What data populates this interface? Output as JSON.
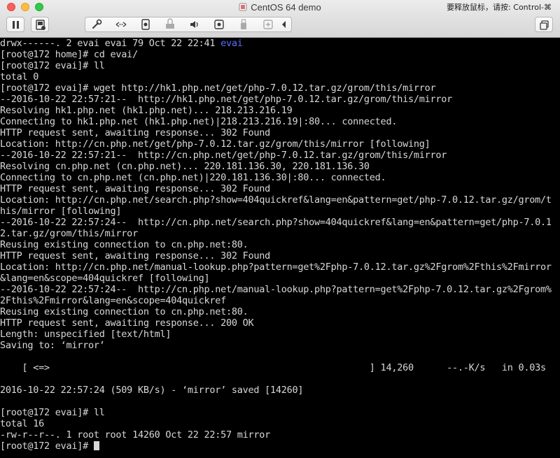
{
  "window": {
    "title": "CentOS 64 demo",
    "release_hint": "要释放鼠标，请按: Control-⌘",
    "colors": {
      "close": "#fc605c",
      "minimize": "#fdbc40",
      "zoom": "#34c84a",
      "terminal_bg": "#000000",
      "terminal_fg": "#d8d8d8",
      "directory": "#5c6cff"
    }
  },
  "toolbar": {
    "left": [
      {
        "name": "pause-button",
        "icon": "pause-icon"
      },
      {
        "name": "snapshot-button",
        "icon": "snapshot-icon"
      }
    ],
    "group": [
      {
        "name": "settings-button",
        "icon": "wrench-icon"
      },
      {
        "name": "network-button",
        "icon": "network-arrows-icon"
      },
      {
        "name": "hard-disk-button",
        "icon": "disk-icon"
      },
      {
        "name": "printer-button",
        "icon": "printer-icon"
      },
      {
        "name": "sound-button",
        "icon": "speaker-icon"
      },
      {
        "name": "camera-button",
        "icon": "camera-icon"
      },
      {
        "name": "usb-button",
        "icon": "usb-icon"
      },
      {
        "name": "sharing-button",
        "icon": "sharing-icon"
      },
      {
        "name": "more-button",
        "icon": "chevron-left-icon"
      }
    ],
    "right": [
      {
        "name": "fullscreen-button",
        "icon": "fullscreen-icon"
      }
    ]
  },
  "terminal": {
    "first_line": {
      "prefix": "drwx------. 2 evai evai 79 Oct 22 22:41 ",
      "dir": "evai"
    },
    "lines": [
      "[root@172 home]# cd evai/",
      "[root@172 evai]# ll",
      "total 0",
      "[root@172 evai]# wget http://hk1.php.net/get/php-7.0.12.tar.gz/grom/this/mirror",
      "--2016-10-22 22:57:21--  http://hk1.php.net/get/php-7.0.12.tar.gz/grom/this/mirror",
      "Resolving hk1.php.net (hk1.php.net)... 218.213.216.19",
      "Connecting to hk1.php.net (hk1.php.net)|218.213.216.19|:80... connected.",
      "HTTP request sent, awaiting response... 302 Found",
      "Location: http://cn.php.net/get/php-7.0.12.tar.gz/grom/this/mirror [following]",
      "--2016-10-22 22:57:21--  http://cn.php.net/get/php-7.0.12.tar.gz/grom/this/mirror",
      "Resolving cn.php.net (cn.php.net)... 220.181.136.30, 220.181.136.30",
      "Connecting to cn.php.net (cn.php.net)|220.181.136.30|:80... connected.",
      "HTTP request sent, awaiting response... 302 Found",
      "Location: http://cn.php.net/search.php?show=404quickref&lang=en&pattern=get/php-7.0.12.tar.gz/grom/t",
      "his/mirror [following]",
      "--2016-10-22 22:57:24--  http://cn.php.net/search.php?show=404quickref&lang=en&pattern=get/php-7.0.1",
      "2.tar.gz/grom/this/mirror",
      "Reusing existing connection to cn.php.net:80.",
      "HTTP request sent, awaiting response... 302 Found",
      "Location: http://cn.php.net/manual-lookup.php?pattern=get%2Fphp-7.0.12.tar.gz%2Fgrom%2Fthis%2Fmirror",
      "&lang=en&scope=404quickref [following]",
      "--2016-10-22 22:57:24--  http://cn.php.net/manual-lookup.php?pattern=get%2Fphp-7.0.12.tar.gz%2Fgrom%",
      "2Fthis%2Fmirror&lang=en&scope=404quickref",
      "Reusing existing connection to cn.php.net:80.",
      "HTTP request sent, awaiting response... 200 OK",
      "Length: unspecified [text/html]",
      "Saving to: ‘mirror’",
      "",
      "    [ <=>                                                          ] 14,260      --.-K/s   in 0.03s",
      "",
      "2016-10-22 22:57:24 (509 KB/s) - ‘mirror’ saved [14260]",
      "",
      "[root@172 evai]# ll",
      "total 16",
      "-rw-r--r--. 1 root root 14260 Oct 22 22:57 mirror"
    ],
    "prompt": "[root@172 evai]# "
  }
}
